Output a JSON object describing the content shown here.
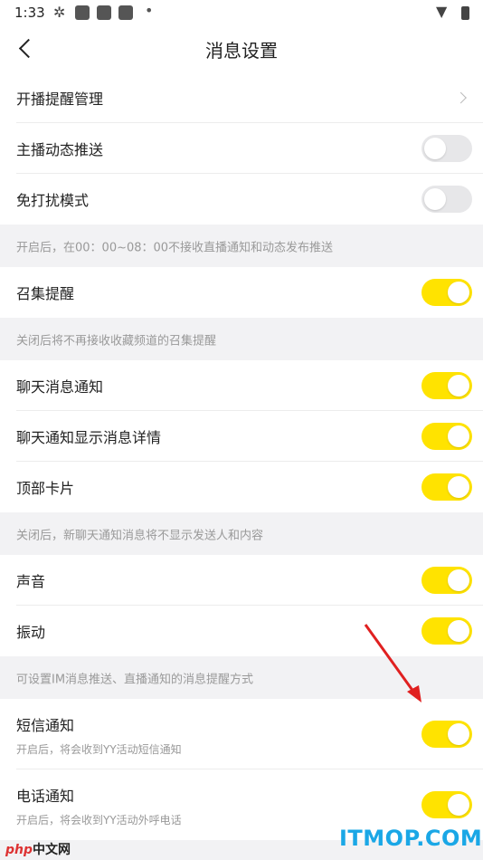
{
  "status": {
    "time": "1:33"
  },
  "nav": {
    "title": "消息设置"
  },
  "rows": {
    "live_remind": {
      "label": "开播提醒管理"
    },
    "anchor_push": {
      "label": "主播动态推送",
      "on": false
    },
    "dnd": {
      "label": "免打扰模式",
      "on": false
    },
    "dnd_note": "开启后，在00：00~08：00不接收直播通知和动态发布推送",
    "gather": {
      "label": "召集提醒",
      "on": true
    },
    "gather_note": "关闭后将不再接收收藏频道的召集提醒",
    "chat_notify": {
      "label": "聊天消息通知",
      "on": true
    },
    "chat_detail": {
      "label": "聊天通知显示消息详情",
      "on": true
    },
    "top_card": {
      "label": "顶部卡片",
      "on": true
    },
    "chat_note": "关闭后，新聊天通知消息将不显示发送人和内容",
    "sound": {
      "label": "声音",
      "on": true
    },
    "vibrate": {
      "label": "振动",
      "on": true
    },
    "sound_note": "可设置IM消息推送、直播通知的消息提醒方式",
    "sms": {
      "label": "短信通知",
      "sub": "开启后，将会收到YY活动短信通知",
      "on": true
    },
    "phone": {
      "label": "电话通知",
      "sub": "开启后，将会收到YY活动外呼电话",
      "on": true
    }
  },
  "watermarks": {
    "php": "php",
    "php_cn": "中文网",
    "itmop": "ITMOP.COM"
  },
  "colors": {
    "toggle_on": "#ffe300",
    "toggle_off": "#e7e7e9",
    "arrow": "#e02020"
  }
}
